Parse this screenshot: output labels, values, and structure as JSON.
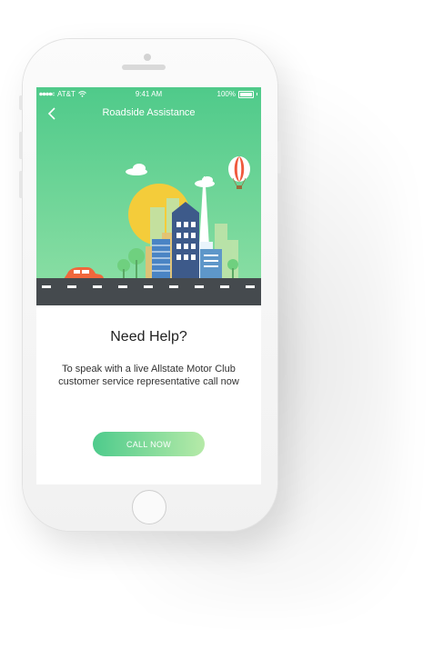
{
  "status_bar": {
    "carrier": "AT&T",
    "time": "9:41 AM",
    "battery": "100%",
    "signal_icon": "signal-dots-icon",
    "wifi_icon": "wifi-icon",
    "battery_icon": "battery-icon"
  },
  "nav": {
    "title": "Roadside Assistance",
    "back_icon": "chevron-left-icon"
  },
  "main": {
    "headline": "Need Help?",
    "description": "To speak with a live Allstate Motor Club customer service representative call now",
    "cta_label": "CALL NOW"
  },
  "colors": {
    "accent_green": "#4ecb8c",
    "hero_top": "#4fca8a",
    "hero_bottom": "#8fe0a6",
    "car_orange": "#f0673c",
    "road": "#454a4e"
  }
}
